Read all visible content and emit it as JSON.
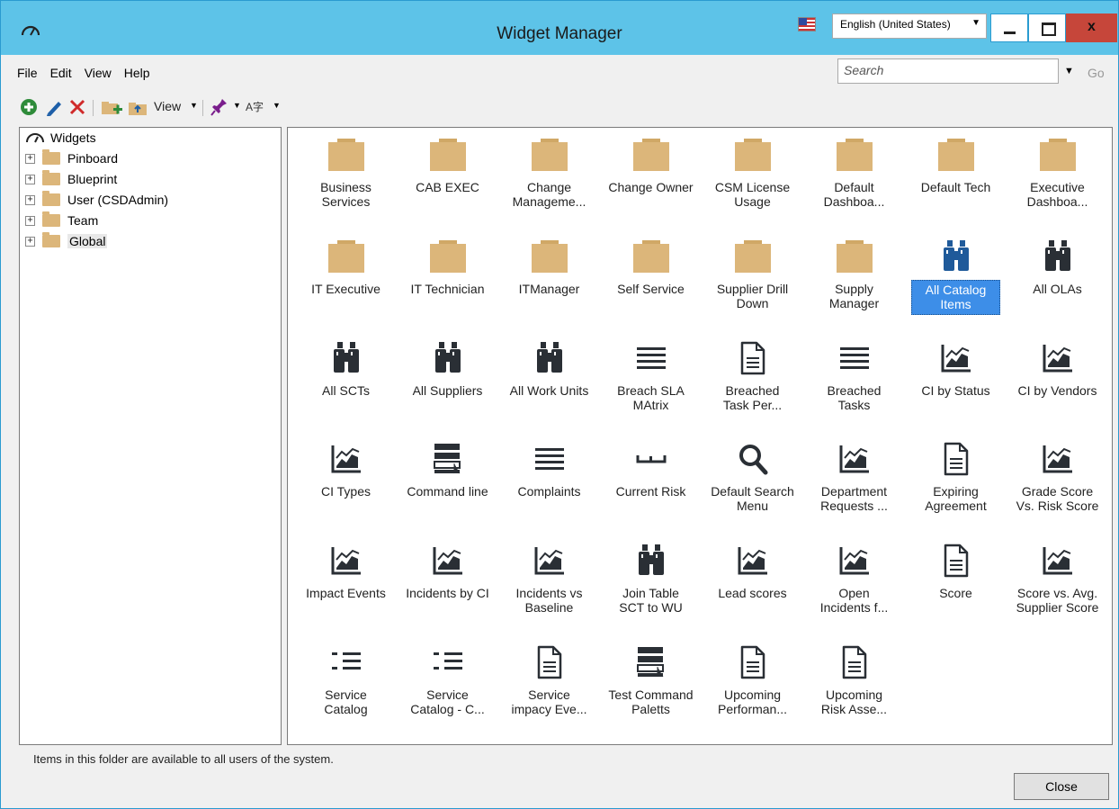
{
  "window": {
    "title": "Widget Manager",
    "language": "English (United States)",
    "close_glyph": "x"
  },
  "menu": [
    "File",
    "Edit",
    "View",
    "Help"
  ],
  "search": {
    "placeholder": "Search",
    "go_label": "Go"
  },
  "toolbar": {
    "view_label": "View"
  },
  "tree": {
    "root": "Widgets",
    "nodes": [
      {
        "label": "Pinboard"
      },
      {
        "label": "Blueprint"
      },
      {
        "label": "User (CSDAdmin)"
      },
      {
        "label": "Team"
      },
      {
        "label": "Global",
        "selected": true,
        "open": true
      }
    ]
  },
  "items": [
    {
      "l1": "Business",
      "l2": "Services",
      "icon": "folder"
    },
    {
      "l1": "CAB EXEC",
      "l2": "",
      "icon": "folder"
    },
    {
      "l1": "Change",
      "l2": "Manageme...",
      "icon": "folder"
    },
    {
      "l1": "Change Owner",
      "l2": "",
      "icon": "folder"
    },
    {
      "l1": "CSM License",
      "l2": "Usage",
      "icon": "folder"
    },
    {
      "l1": "Default",
      "l2": "Dashboa...",
      "icon": "folder"
    },
    {
      "l1": "Default Tech",
      "l2": "",
      "icon": "folder"
    },
    {
      "l1": "Executive",
      "l2": "Dashboa...",
      "icon": "folder"
    },
    {
      "l1": "IT Executive",
      "l2": "",
      "icon": "folder"
    },
    {
      "l1": "IT Technician",
      "l2": "",
      "icon": "folder"
    },
    {
      "l1": "ITManager",
      "l2": "",
      "icon": "folder"
    },
    {
      "l1": "Self Service",
      "l2": "",
      "icon": "folder"
    },
    {
      "l1": "Supplier Drill",
      "l2": "Down",
      "icon": "folder"
    },
    {
      "l1": "Supply",
      "l2": "Manager",
      "icon": "folder"
    },
    {
      "l1": "All Catalog",
      "l2": "Items",
      "icon": "binoculars-blue",
      "selected": true
    },
    {
      "l1": "All OLAs",
      "l2": "",
      "icon": "binoculars"
    },
    {
      "l1": "All SCTs",
      "l2": "",
      "icon": "binoculars"
    },
    {
      "l1": "All Suppliers",
      "l2": "",
      "icon": "binoculars"
    },
    {
      "l1": "All Work Units",
      "l2": "",
      "icon": "binoculars"
    },
    {
      "l1": "Breach SLA",
      "l2": "MAtrix",
      "icon": "list"
    },
    {
      "l1": "Breached",
      "l2": "Task Per...",
      "icon": "document"
    },
    {
      "l1": "Breached",
      "l2": "Tasks",
      "icon": "list"
    },
    {
      "l1": "CI by Status",
      "l2": "",
      "icon": "chart"
    },
    {
      "l1": "CI by Vendors",
      "l2": "",
      "icon": "chart"
    },
    {
      "l1": "CI Types",
      "l2": "",
      "icon": "chart"
    },
    {
      "l1": "Command line",
      "l2": "",
      "icon": "command"
    },
    {
      "l1": "Complaints",
      "l2": "",
      "icon": "list"
    },
    {
      "l1": "Current Risk",
      "l2": "",
      "icon": "bracket"
    },
    {
      "l1": "Default Search",
      "l2": "Menu",
      "icon": "search"
    },
    {
      "l1": "Department",
      "l2": "Requests ...",
      "icon": "chart"
    },
    {
      "l1": "Expiring",
      "l2": "Agreement",
      "icon": "document"
    },
    {
      "l1": "Grade Score",
      "l2": "Vs. Risk Score",
      "icon": "chart"
    },
    {
      "l1": "Impact Events",
      "l2": "",
      "icon": "chart"
    },
    {
      "l1": "Incidents by CI",
      "l2": "",
      "icon": "chart"
    },
    {
      "l1": "Incidents vs",
      "l2": "Baseline",
      "icon": "chart"
    },
    {
      "l1": "Join Table",
      "l2": "SCT to WU",
      "icon": "binoculars"
    },
    {
      "l1": "Lead scores",
      "l2": "",
      "icon": "chart"
    },
    {
      "l1": "Open",
      "l2": "Incidents f...",
      "icon": "chart"
    },
    {
      "l1": "Score",
      "l2": "",
      "icon": "document"
    },
    {
      "l1": "Score vs. Avg.",
      "l2": "Supplier Score",
      "icon": "chart"
    },
    {
      "l1": "Service",
      "l2": "Catalog",
      "icon": "outline"
    },
    {
      "l1": "Service",
      "l2": "Catalog - C...",
      "icon": "outline"
    },
    {
      "l1": "Service",
      "l2": "impacy Eve...",
      "icon": "document"
    },
    {
      "l1": "Test Command",
      "l2": "Paletts",
      "icon": "command"
    },
    {
      "l1": "Upcoming",
      "l2": "Performan...",
      "icon": "document"
    },
    {
      "l1": "Upcoming",
      "l2": "Risk Asse...",
      "icon": "document"
    }
  ],
  "status": "Items in this folder are available to all users of the system.",
  "close_label": "Close",
  "colors": {
    "titlebar": "#5dc3e8",
    "selection": "#3d8ee8",
    "folder": "#dcb67a",
    "close_button": "#c6463a"
  }
}
